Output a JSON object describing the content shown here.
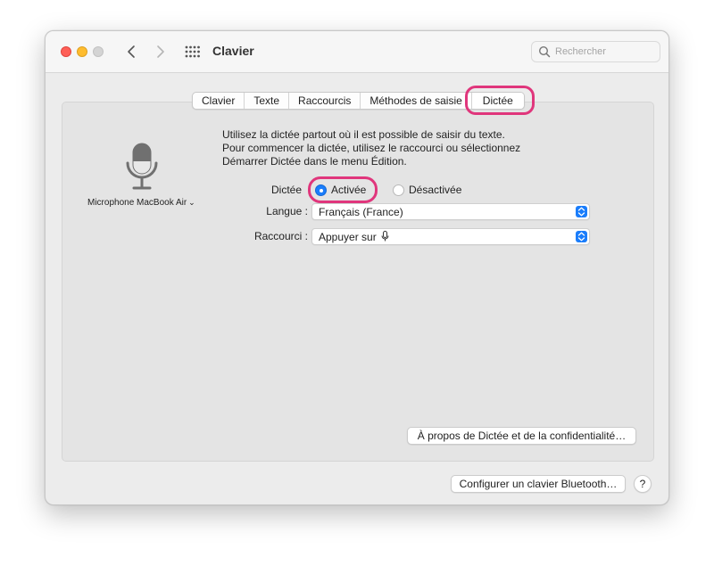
{
  "window": {
    "title": "Clavier",
    "search_placeholder": "Rechercher"
  },
  "tabs": [
    {
      "label": "Clavier"
    },
    {
      "label": "Texte"
    },
    {
      "label": "Raccourcis"
    },
    {
      "label": "Méthodes de saisie"
    },
    {
      "label": "Dictée",
      "active": true
    }
  ],
  "microphone": {
    "label": "Microphone MacBook Air",
    "icon": "microphone-icon"
  },
  "description": {
    "line1": "Utilisez la dictée partout où il est possible de saisir du texte.",
    "line2": "Pour commencer la dictée, utilisez le raccourci ou sélectionnez",
    "line3": "Démarrer Dictée dans le menu Édition."
  },
  "dictee": {
    "label": "Dictée",
    "options": [
      "Activée",
      "Désactivée"
    ],
    "selected": "Activée"
  },
  "langue": {
    "label": "Langue :",
    "value": "Français (France)"
  },
  "raccourci": {
    "label": "Raccourci :",
    "value": "Appuyer sur"
  },
  "buttons": {
    "about": "À propos de Dictée et de la confidentialité…",
    "bluetooth": "Configurer un clavier Bluetooth…",
    "help": "?"
  },
  "colors": {
    "accent": "#1a7dfb",
    "highlight": "#e0367c"
  }
}
